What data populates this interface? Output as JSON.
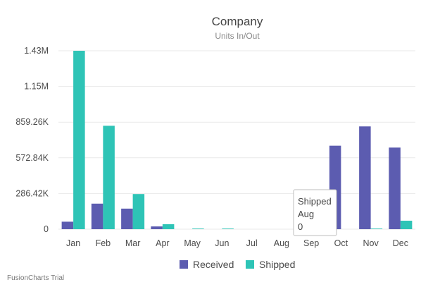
{
  "chart_data": {
    "type": "bar",
    "title": "Company",
    "subtitle": "Units In/Out",
    "categories": [
      "Jan",
      "Feb",
      "Mar",
      "Apr",
      "May",
      "Jun",
      "Jul",
      "Aug",
      "Sep",
      "Oct",
      "Nov",
      "Dec"
    ],
    "series": [
      {
        "name": "Received",
        "color": "#5c5cb0",
        "values": [
          60000,
          205000,
          165000,
          22000,
          0,
          0,
          0,
          0,
          0,
          670000,
          825000,
          655000
        ]
      },
      {
        "name": "Shipped",
        "color": "#2ec4b6",
        "values": [
          1432000,
          830000,
          282000,
          40000,
          5000,
          5000,
          0,
          0,
          0,
          0,
          5000,
          68000
        ]
      }
    ],
    "ylim": [
      0,
      1432100
    ],
    "yticks": [
      0,
      286420,
      572840,
      859260,
      1145680,
      1432100
    ],
    "ytick_labels": [
      "0",
      "286.42K",
      "572.84K",
      "859.26K",
      "1.15M",
      "1.43M"
    ],
    "grid": true,
    "legend": "bottom"
  },
  "tooltip": {
    "lines": [
      "Shipped",
      "Aug",
      "0"
    ]
  },
  "watermark": "FusionCharts Trial"
}
